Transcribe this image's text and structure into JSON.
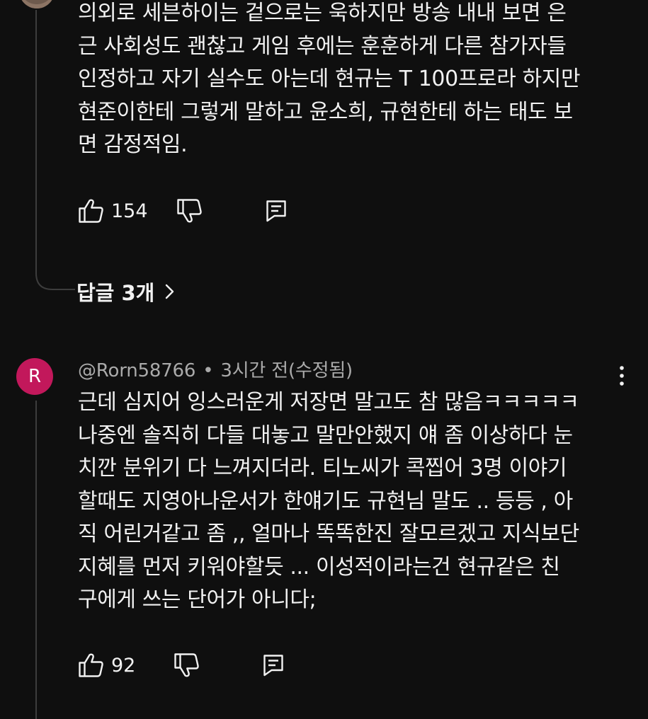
{
  "comment_prev": {
    "body": "의외로 세븐하이는 겉으로는 욱하지만 방송 내내 보면 은\n근 사회성도 괜찮고 게임 후에는 훈훈하게 다른 참가자들\n인정하고 자기 실수도 아는데 현규는 T 100프로라 하지만\n현준이한테 그렇게 말하고 윤소희, 규현한테 하는 태도 보\n면 감정적임.",
    "likes": "154",
    "replies_label": "답글 3개"
  },
  "comment": {
    "avatar_letter": "R",
    "author": "@Rorn58766",
    "separator": "•",
    "time": "3시간 전(수정됨)",
    "body": "근데 심지어 잉스러운게 저장면 말고도 참 많음ㅋㅋㅋㅋㅋ\n나중엔 솔직히 다들 대놓고 말만안했지 얘 좀 이상하다 눈\n치깐 분위기 다 느껴지더라.  티노씨가 콕찝어 3명 이야기\n할때도 지영아나운서가 한얘기도 규현님 말도 .. 등등 , 아\n직 어린거같고 좀 ,, 얼마나 똑똑한진 잘모르겠고 지식보단\n지혜를  먼저 키워야할듯 ... 이성적이라는건 현규같은 친\n구에게 쓰는 단어가 아니다;",
    "likes": "92"
  },
  "icons": {
    "like": "thumbs-up-icon",
    "dislike": "thumbs-down-icon",
    "reply": "reply-icon",
    "chevron": "chevron-right-icon",
    "menu": "more-vert-icon"
  },
  "colors": {
    "background": "#0f0f0f",
    "text": "#f1f1f1",
    "meta_text": "#aaaaaa",
    "avatar_bg": "#c2185b",
    "thread_line": "#3d3d3d"
  }
}
